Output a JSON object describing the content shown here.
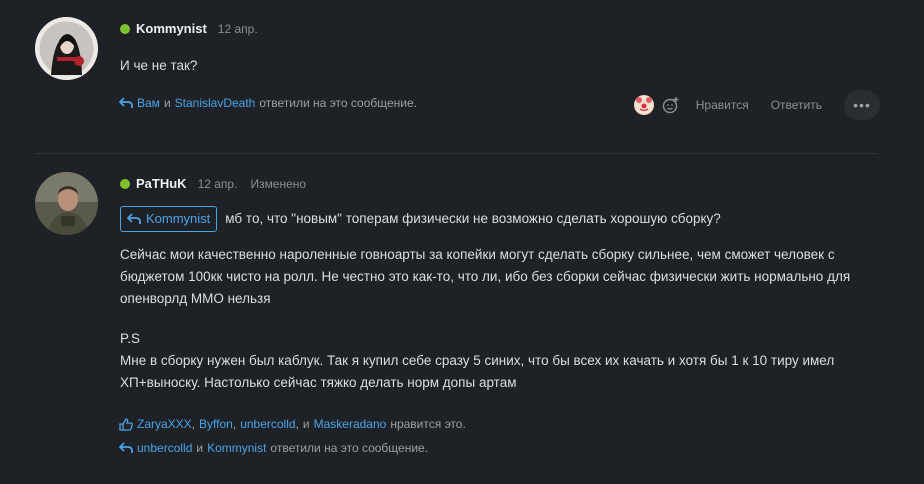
{
  "posts": [
    {
      "author": "Kommynist",
      "date": "12 апр.",
      "text": "И че не так?",
      "replies": {
        "users": [
          "Вам",
          "StanislavDeath"
        ],
        "joiner": "и",
        "suffix": "ответили на это сообщение."
      },
      "actions": {
        "like": "Нравится",
        "reply": "Ответить",
        "more": "•••"
      }
    },
    {
      "author": "PaTHuK",
      "date": "12 апр.",
      "edited": "Изменено",
      "quote_user": "Kommynist",
      "quote_text": "мб то, что \"новым\" топерам физически не возможно сделать хорошую сборку?",
      "paragraph1_lines": [
        "Сейчас мои качественно нароленные говноарты за копейки могут сделать сборку сильнее, чем сможет человек с",
        "бюджетом 100кк чисто на ролл. Не честно это как-то, что ли, ибо без сборки сейчас физически жить нормально для",
        "опенворлд ММО нельзя"
      ],
      "paragraph2_lines": [
        "P.S",
        "Мне в сборку нужен был каблук. Так я купил себе сразу 5 синих, что бы всех их качать и хотя бы 1 к 10 тиру имел",
        "ХП+выноску. Настолько сейчас тяжко делать норм допы артам"
      ],
      "likes": {
        "users": [
          "ZaryaXXX",
          "Byffon",
          "unbercolld",
          "Maskeradano"
        ],
        "separator": ",",
        "joiner": "и",
        "suffix": "нравится это."
      },
      "replies": {
        "users": [
          "unbercolld",
          "Kommynist"
        ],
        "joiner": "и",
        "suffix": "ответили на это сообщение."
      }
    }
  ],
  "colors": {
    "background": "#1e2125",
    "link": "#4aa4ea",
    "online": "#7ec230",
    "muted": "#8b9096"
  }
}
